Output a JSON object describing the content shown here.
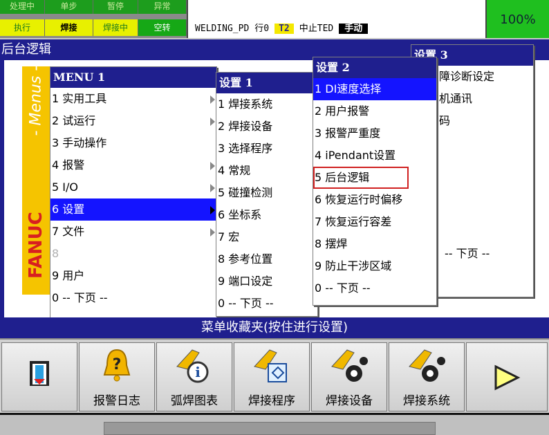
{
  "status": {
    "row1": [
      "处理中",
      "单步",
      "暂停",
      "异常"
    ],
    "row2": [
      "执行",
      "焊接",
      "焊接中",
      "空转"
    ]
  },
  "program": {
    "name": "WELDING_PD",
    "line": "行0",
    "tool": "T2",
    "state": "中止TED",
    "mode": "手动"
  },
  "override": "100%",
  "screen_title": "后台逻辑",
  "fanuc": {
    "menus_label": "- Menus -",
    "brand": "FANUC"
  },
  "menu1": {
    "title": "MENU  1",
    "items": [
      {
        "num": "1",
        "label": "实用工具"
      },
      {
        "num": "2",
        "label": "试运行"
      },
      {
        "num": "3",
        "label": "手动操作"
      },
      {
        "num": "4",
        "label": "报警"
      },
      {
        "num": "5",
        "label": "I/O"
      },
      {
        "num": "6",
        "label": "设置"
      },
      {
        "num": "7",
        "label": "文件"
      },
      {
        "num": "8",
        "label": ""
      },
      {
        "num": "9",
        "label": "用户"
      },
      {
        "num": "0",
        "label": "-- 下页 --"
      }
    ]
  },
  "menu_setup1": {
    "title": "设置  1",
    "items": [
      {
        "num": "1",
        "label": "焊接系统"
      },
      {
        "num": "2",
        "label": "焊接设备"
      },
      {
        "num": "3",
        "label": "选择程序"
      },
      {
        "num": "4",
        "label": "常规"
      },
      {
        "num": "5",
        "label": "碰撞检测"
      },
      {
        "num": "6",
        "label": "坐标系"
      },
      {
        "num": "7",
        "label": "宏"
      },
      {
        "num": "8",
        "label": "参考位置"
      },
      {
        "num": "9",
        "label": "端口设定"
      },
      {
        "num": "0",
        "label": "-- 下页 --"
      }
    ]
  },
  "menu_setup2": {
    "title": "设置  2",
    "items": [
      {
        "num": "1",
        "label": "DI速度选择"
      },
      {
        "num": "2",
        "label": "用户报警"
      },
      {
        "num": "3",
        "label": "报警严重度"
      },
      {
        "num": "4",
        "label": "iPendant设置"
      },
      {
        "num": "5",
        "label": "后台逻辑"
      },
      {
        "num": "6",
        "label": "恢复运行时偏移"
      },
      {
        "num": "7",
        "label": "恢复运行容差"
      },
      {
        "num": "8",
        "label": "摆焊"
      },
      {
        "num": "9",
        "label": "防止干涉区域"
      },
      {
        "num": "0",
        "label": "-- 下页 --"
      }
    ]
  },
  "menu_setup3": {
    "title": "设置  3",
    "items": [
      "障诊断设定",
      "机通讯",
      "码",
      "",
      "",
      "",
      "",
      "",
      "-- 下页 --"
    ]
  },
  "favorites_bar": "菜单收藏夹(按住进行设置)",
  "toolbar": [
    {
      "icon": "exit-door-icon",
      "label": ""
    },
    {
      "icon": "alarm-bell-icon",
      "label": "报警日志"
    },
    {
      "icon": "weld-chart-icon",
      "label": "弧焊图表"
    },
    {
      "icon": "weld-program-icon",
      "label": "焊接程序"
    },
    {
      "icon": "weld-equipment-icon",
      "label": "焊接设备"
    },
    {
      "icon": "weld-system-icon",
      "label": "焊接系统"
    },
    {
      "icon": "next-arrow-icon",
      "label": ""
    }
  ]
}
